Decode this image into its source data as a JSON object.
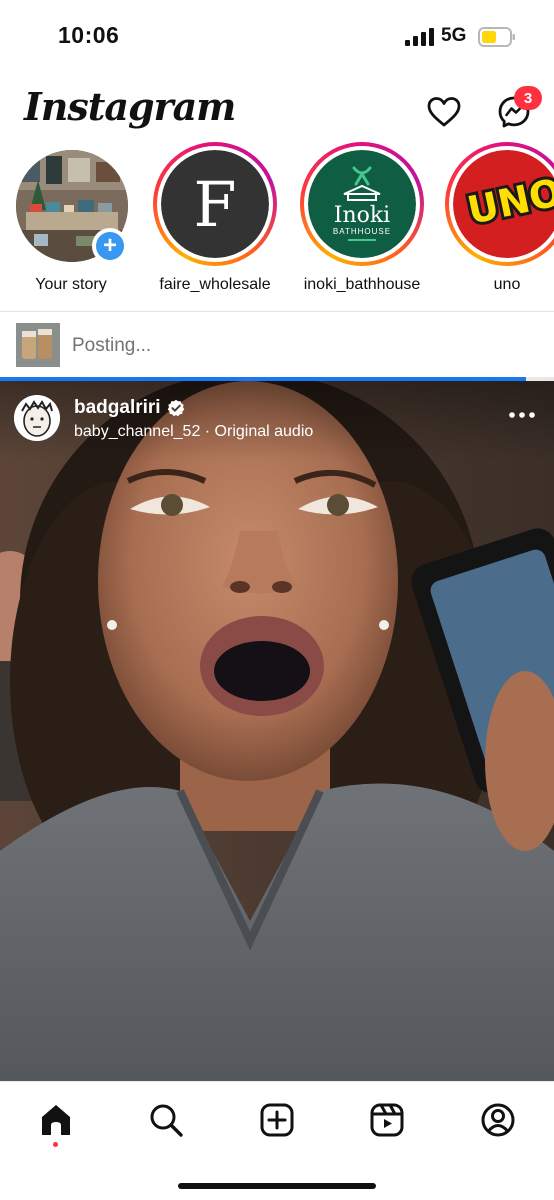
{
  "status_bar": {
    "time": "10:06",
    "network": "5G",
    "icons": [
      "signal-icon",
      "battery-icon"
    ]
  },
  "header": {
    "logo": "Instagram",
    "messages_badge": "3",
    "icons": [
      "heart-icon",
      "messenger-icon"
    ]
  },
  "stories": [
    {
      "label": "Your story",
      "avatar_text": ""
    },
    {
      "label": "faire_wholesale",
      "avatar_text": "F"
    },
    {
      "label": "inoki_bathhouse",
      "avatar_text": "Inoki",
      "avatar_subtext": "BATHHOUSE"
    },
    {
      "label": "uno",
      "avatar_text": "UNO"
    }
  ],
  "posting": {
    "text": "Posting...",
    "progress": 0.95
  },
  "post": {
    "username": "badgalriri",
    "audio_line": "baby_channel_52 · Original audio",
    "verified": true
  },
  "bottom_nav": {
    "items": [
      "home-icon",
      "search-icon",
      "create-icon",
      "reels-icon",
      "profile-icon"
    ],
    "active": "home-icon"
  },
  "colors": {
    "badge_red": "#ff3040",
    "blue": "#1877f2",
    "verified_blue": "#3897f0",
    "inoki_green": "#0f5e43",
    "uno_red": "#d31f1f",
    "uno_yellow": "#ffde00",
    "faire_dark": "#333333"
  }
}
